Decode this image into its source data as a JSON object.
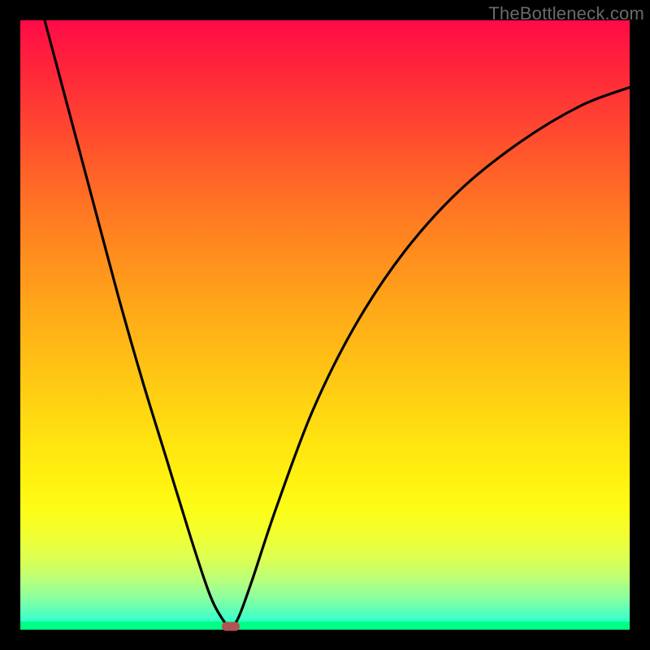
{
  "watermark": "TheBottleneck.com",
  "chart_data": {
    "type": "line",
    "title": "",
    "xlabel": "",
    "ylabel": "",
    "xlim": [
      0,
      100
    ],
    "ylim": [
      0,
      100
    ],
    "series": [
      {
        "name": "curve",
        "x": [
          4,
          8,
          12,
          16,
          20,
          24,
          28,
          31,
          33,
          34.5,
          35.8,
          38,
          42,
          48,
          55,
          63,
          72,
          82,
          92,
          100
        ],
        "y": [
          100,
          85,
          70,
          55,
          41,
          28,
          15,
          6,
          2,
          0.5,
          2,
          8,
          20,
          36,
          50,
          62,
          72,
          80,
          86,
          89
        ]
      }
    ],
    "marker": {
      "x": 34.5,
      "y": 0.5
    },
    "gradient_stops": [
      {
        "pos": 0,
        "color": "#ff0a47"
      },
      {
        "pos": 50,
        "color": "#ffbd15"
      },
      {
        "pos": 80,
        "color": "#fcfd1a"
      },
      {
        "pos": 100,
        "color": "#00ffe0"
      }
    ]
  }
}
